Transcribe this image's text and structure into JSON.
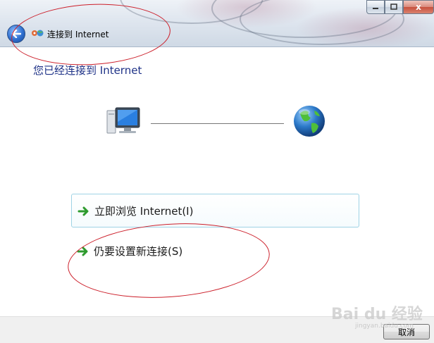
{
  "window": {
    "title": "连接到 Internet",
    "title_icon": "network-icon",
    "caption_buttons": {
      "minimize_icon": "minimize-icon",
      "maximize_icon": "maximize-icon",
      "close_icon": "close-icon",
      "close_label": "x"
    },
    "back_icon": "back-arrow-icon"
  },
  "content": {
    "heading": "您已经连接到 Internet",
    "diagram": {
      "left_icon": "computer-icon",
      "right_icon": "globe-icon"
    },
    "commands": [
      {
        "label": "立即浏览 Internet(I)",
        "icon": "green-arrow-icon"
      },
      {
        "label": "仍要设置新连接(S)",
        "icon": "green-arrow-icon"
      }
    ]
  },
  "footer": {
    "cancel_label": "取消"
  },
  "watermark": {
    "main": "Bai du 经验",
    "sub": "jingyan.baidu.com"
  },
  "colors": {
    "heading": "#1e3287",
    "annotation": "#cc1f2a",
    "arrow": "#2e9b2e"
  }
}
